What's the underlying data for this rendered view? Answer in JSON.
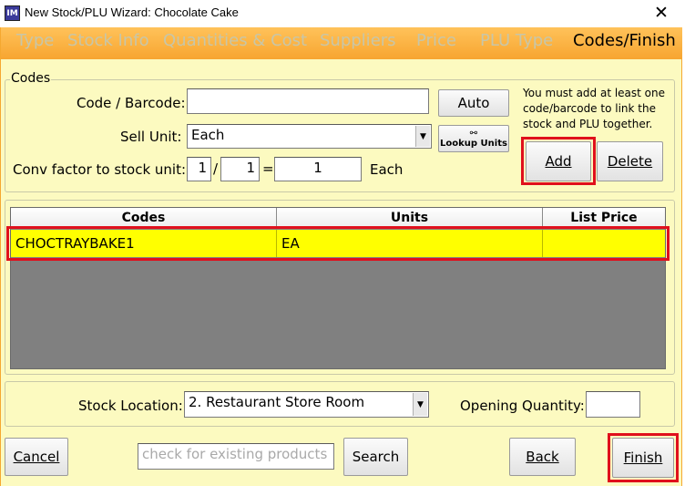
{
  "window": {
    "app_icon": "IM",
    "title": "New Stock/PLU Wizard: Chocolate Cake",
    "close_glyph": "✕"
  },
  "tabs": [
    {
      "label": "Type",
      "active": false
    },
    {
      "label": "Stock Info",
      "active": false
    },
    {
      "label": "Quantities & Cost",
      "active": false
    },
    {
      "label": "Suppliers",
      "active": false
    },
    {
      "label": "Price",
      "active": false
    },
    {
      "label": "PLU Type",
      "active": false
    },
    {
      "label": "Codes/Finish",
      "active": true
    }
  ],
  "codes": {
    "legend": "Codes",
    "code_label": "Code / Barcode:",
    "code_value": "",
    "auto_label": "Auto",
    "sell_unit_label": "Sell Unit:",
    "sell_unit_value": "Each",
    "lookup_units_label": "Lookup Units",
    "lookup_icon": "binoculars-icon",
    "conv_label": "Conv factor to stock unit:",
    "conv_numerator": "1",
    "conv_slash": "/",
    "conv_denominator": "1",
    "conv_equals": "=",
    "conv_result": "1",
    "conv_unit": "Each",
    "info_text": "You must add at least one code/barcode to link the stock and PLU together.",
    "add_label": "Add",
    "delete_label": "Delete"
  },
  "grid": {
    "columns": [
      "Codes",
      "Units",
      "List Price"
    ],
    "rows": [
      {
        "code": "CHOCTRAYBAKE1",
        "units": "EA",
        "list_price": ""
      }
    ]
  },
  "location": {
    "stock_location_label": "Stock Location:",
    "stock_location_value": "2. Restaurant Store Room",
    "opening_qty_label": "Opening Quantity:",
    "opening_qty_value": ""
  },
  "footer": {
    "cancel_label": "Cancel",
    "search_placeholder": "check for existing products",
    "search_label": "Search",
    "back_label": "Back",
    "finish_label": "Finish"
  },
  "colors": {
    "tab_strip": "#f7a530",
    "background": "#fcfac0",
    "highlight_row": "#ffff00",
    "annotation": "#e0101c"
  }
}
